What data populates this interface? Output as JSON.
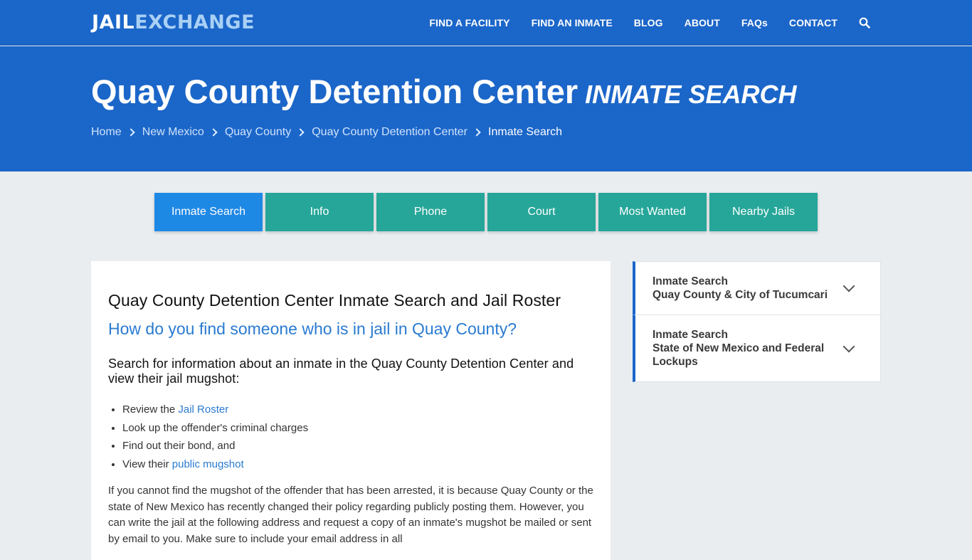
{
  "logo": {
    "part1": "JAIL",
    "part2": "EXCHANGE"
  },
  "nav": {
    "items": [
      "FIND A FACILITY",
      "FIND AN INMATE",
      "BLOG",
      "ABOUT",
      "FAQs",
      "CONTACT"
    ],
    "search_icon": "search-icon"
  },
  "hero": {
    "title": "Quay County Detention Center",
    "subtitle": "INMATE SEARCH",
    "breadcrumb": [
      "Home",
      "New Mexico",
      "Quay County",
      "Quay County Detention Center",
      "Inmate Search"
    ]
  },
  "tabs": [
    {
      "label": "Inmate Search",
      "active": true
    },
    {
      "label": "Info",
      "active": false
    },
    {
      "label": "Phone",
      "active": false
    },
    {
      "label": "Court",
      "active": false
    },
    {
      "label": "Most Wanted",
      "active": false
    },
    {
      "label": "Nearby Jails",
      "active": false
    }
  ],
  "main": {
    "heading": "Quay County Detention Center Inmate Search and Jail Roster",
    "question": "How do you find someone who is in jail in Quay County?",
    "subheading": "Search for information about an inmate in the Quay County Detention Center and view their jail mugshot:",
    "list": [
      {
        "prefix": "Review the ",
        "link": "Jail Roster"
      },
      {
        "prefix": "Look up the offender's criminal charges",
        "link": ""
      },
      {
        "prefix": "Find out their bond, and",
        "link": ""
      },
      {
        "prefix": "View their ",
        "link": "public mugshot"
      }
    ],
    "paragraph": "If you cannot find the mugshot of the offender that has been arrested, it is because Quay County or the state of New Mexico has recently changed their policy regarding publicly posting them. However, you can write the jail at the following address and request a copy of an inmate's mugshot be mailed or sent by email to you. Make sure to include your email address in all"
  },
  "sidebar": {
    "items": [
      {
        "title": "Inmate Search",
        "subtitle": "Quay County & City of Tucumcari"
      },
      {
        "title": "Inmate Search",
        "subtitle": "State of New Mexico and Federal Lockups"
      }
    ]
  },
  "colors": {
    "header_blue": "#1b66c9",
    "tab_teal": "#26a699",
    "tab_active_blue": "#1e88e5",
    "link_blue": "#2a7bd1"
  }
}
